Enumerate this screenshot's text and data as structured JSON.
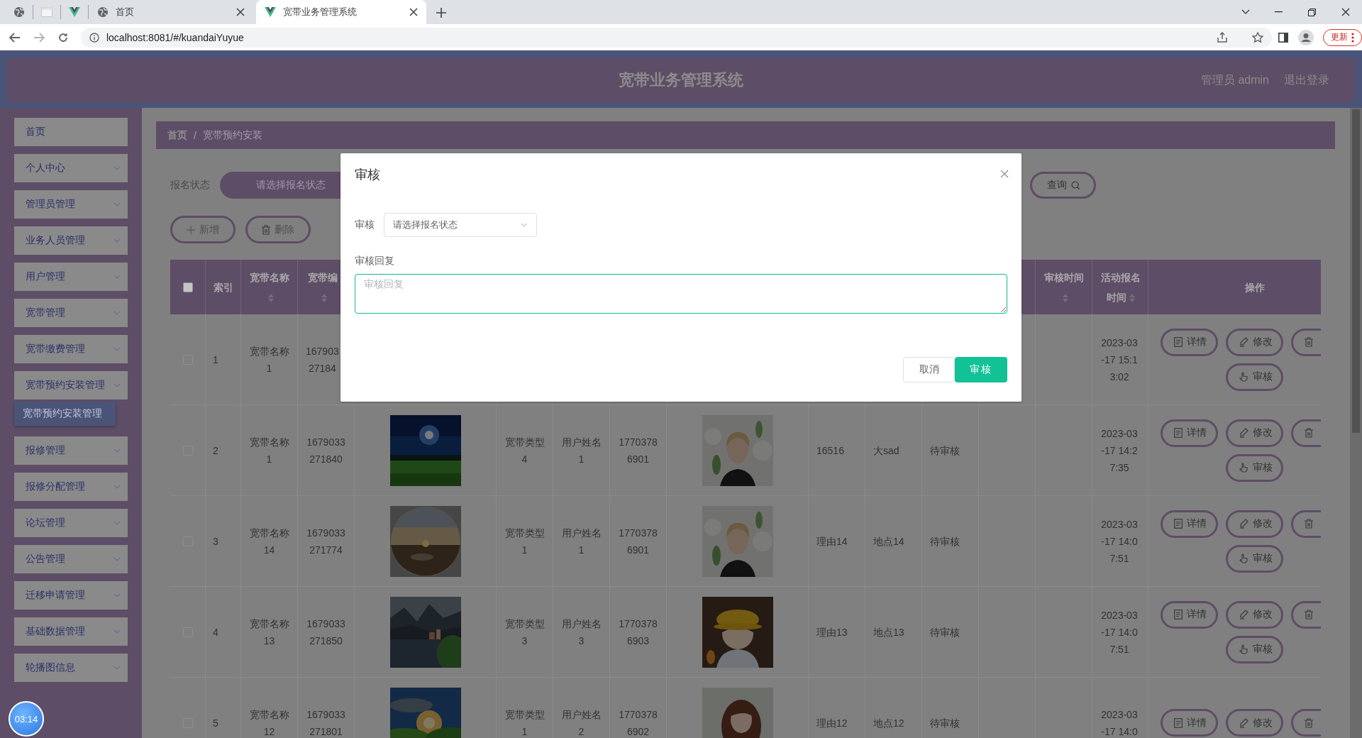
{
  "browser": {
    "tabs": [
      {
        "title": "首页",
        "selected": false
      },
      {
        "title": "宽带业务管理系统",
        "selected": true
      }
    ],
    "address": "localhost:8081/#/kuandaiYuyue",
    "update_button": "更新"
  },
  "header": {
    "title": "宽带业务管理系统",
    "user": "管理员 admin",
    "logout": "退出登录"
  },
  "sidebar": {
    "items": [
      {
        "label": "首页",
        "kind": "link"
      },
      {
        "label": "个人中心",
        "kind": "menu"
      },
      {
        "label": "管理员管理",
        "kind": "menu"
      },
      {
        "label": "业务人员管理",
        "kind": "menu"
      },
      {
        "label": "用户管理",
        "kind": "menu"
      },
      {
        "label": "宽带管理",
        "kind": "menu"
      },
      {
        "label": "宽带缴费管理",
        "kind": "menu"
      },
      {
        "label": "宽带预约安装管理",
        "kind": "menu",
        "children": [
          {
            "label": "宽带预约安装管理",
            "selected": true
          }
        ]
      },
      {
        "label": "报修管理",
        "kind": "menu"
      },
      {
        "label": "报修分配管理",
        "kind": "menu"
      },
      {
        "label": "论坛管理",
        "kind": "menu"
      },
      {
        "label": "公告管理",
        "kind": "menu"
      },
      {
        "label": "迁移申请管理",
        "kind": "menu"
      },
      {
        "label": "基础数据管理",
        "kind": "menu"
      },
      {
        "label": "轮播图信息",
        "kind": "menu"
      }
    ]
  },
  "breadcrumb": {
    "items": [
      "首页",
      "宽带预约安装"
    ],
    "separator": "/"
  },
  "search": {
    "label": "报名状态",
    "placeholder": "请选择报名状态",
    "button": "查询"
  },
  "toolbar": [
    {
      "kind": "add",
      "label": "新增"
    },
    {
      "kind": "delete",
      "label": "删除"
    }
  ],
  "table": {
    "select_all": {
      "checked": false
    },
    "columns": [
      {
        "kind": "header",
        "label": "索引",
        "sortable": false
      },
      {
        "kind": "header",
        "label": "宽带名称",
        "sortable": true
      },
      {
        "kind": "header",
        "label": "宽带编",
        "sortable": true
      },
      {
        "kind": "covered"
      },
      {
        "kind": "covered"
      },
      {
        "kind": "covered"
      },
      {
        "kind": "covered"
      },
      {
        "kind": "covered"
      },
      {
        "kind": "covered"
      },
      {
        "kind": "covered"
      },
      {
        "kind": "covered"
      },
      {
        "kind": "covered"
      },
      {
        "kind": "header",
        "label": "审核时间",
        "sortable": true
      },
      {
        "kind": "header",
        "label": "活动报名时间",
        "sortable": true
      },
      {
        "kind": "header",
        "label": "操作",
        "sortable": false
      }
    ],
    "rows": [
      {
        "checked": false,
        "cells": [
          {
            "kind": "text",
            "text": "1"
          },
          {
            "kind": "text",
            "text": "宽带名称1"
          },
          {
            "kind": "text",
            "text": "167903\n27184"
          },
          {
            "kind": "blank"
          },
          {
            "kind": "blank"
          },
          {
            "kind": "blank"
          },
          {
            "kind": "blank"
          },
          {
            "kind": "blank"
          },
          {
            "kind": "blank"
          },
          {
            "kind": "blank"
          },
          {
            "kind": "blank"
          },
          {
            "kind": "blank"
          },
          {
            "kind": "blank"
          },
          {
            "kind": "text",
            "text": "2023-03-17 15:13:02"
          }
        ],
        "actions": [
          {
            "kind": "detail",
            "label": "详情"
          },
          {
            "kind": "edit",
            "label": "修改"
          },
          {
            "kind": "delete"
          },
          {
            "kind": "review",
            "label": "审核"
          }
        ]
      },
      {
        "checked": false,
        "cells": [
          {
            "kind": "text",
            "text": "2"
          },
          {
            "kind": "text",
            "text": "宽带名称1"
          },
          {
            "kind": "text",
            "text": "1679033271840"
          },
          {
            "kind": "picture"
          },
          {
            "kind": "text",
            "text": "宽带类型4"
          },
          {
            "kind": "text",
            "text": "用户姓名1"
          },
          {
            "kind": "text",
            "text": "17703786901"
          },
          {
            "kind": "picture"
          },
          {
            "kind": "text",
            "text": "16516"
          },
          {
            "kind": "text",
            "text": "大sad"
          },
          {
            "kind": "text",
            "text": "待审核"
          },
          {
            "kind": "blank"
          },
          {
            "kind": "blank"
          },
          {
            "kind": "text",
            "text": "2023-03-17 14:27:35"
          }
        ],
        "actions": [
          {
            "kind": "detail",
            "label": "详情"
          },
          {
            "kind": "edit",
            "label": "修改"
          },
          {
            "kind": "delete"
          },
          {
            "kind": "review",
            "label": "审核"
          }
        ]
      },
      {
        "checked": false,
        "cells": [
          {
            "kind": "text",
            "text": "3"
          },
          {
            "kind": "text",
            "text": "宽带名称14"
          },
          {
            "kind": "text",
            "text": "1679033271774"
          },
          {
            "kind": "picture"
          },
          {
            "kind": "text",
            "text": "宽带类型1"
          },
          {
            "kind": "text",
            "text": "用户姓名1"
          },
          {
            "kind": "text",
            "text": "17703786901"
          },
          {
            "kind": "picture"
          },
          {
            "kind": "text",
            "text": "理由14"
          },
          {
            "kind": "text",
            "text": "地点14"
          },
          {
            "kind": "text",
            "text": "待审核"
          },
          {
            "kind": "blank"
          },
          {
            "kind": "blank"
          },
          {
            "kind": "text",
            "text": "2023-03-17 14:07:51"
          }
        ],
        "actions": [
          {
            "kind": "detail",
            "label": "详情"
          },
          {
            "kind": "edit",
            "label": "修改"
          },
          {
            "kind": "delete"
          },
          {
            "kind": "review",
            "label": "审核"
          }
        ]
      },
      {
        "checked": false,
        "cells": [
          {
            "kind": "text",
            "text": "4"
          },
          {
            "kind": "text",
            "text": "宽带名称13"
          },
          {
            "kind": "text",
            "text": "1679033271850"
          },
          {
            "kind": "picture"
          },
          {
            "kind": "text",
            "text": "宽带类型3"
          },
          {
            "kind": "text",
            "text": "用户姓名3"
          },
          {
            "kind": "text",
            "text": "17703786903"
          },
          {
            "kind": "picture"
          },
          {
            "kind": "text",
            "text": "理由13"
          },
          {
            "kind": "text",
            "text": "地点13"
          },
          {
            "kind": "text",
            "text": "待审核"
          },
          {
            "kind": "blank"
          },
          {
            "kind": "blank"
          },
          {
            "kind": "text",
            "text": "2023-03-17 14:07:51"
          }
        ],
        "actions": [
          {
            "kind": "detail",
            "label": "详情"
          },
          {
            "kind": "edit",
            "label": "修改"
          },
          {
            "kind": "delete"
          },
          {
            "kind": "review",
            "label": "审核"
          }
        ]
      },
      {
        "checked": false,
        "cells": [
          {
            "kind": "text",
            "text": "5"
          },
          {
            "kind": "text",
            "text": "宽带名称12"
          },
          {
            "kind": "text",
            "text": "1679033271801"
          },
          {
            "kind": "picture"
          },
          {
            "kind": "text",
            "text": "宽带类型1"
          },
          {
            "kind": "text",
            "text": "用户姓名2"
          },
          {
            "kind": "text",
            "text": "17703786902"
          },
          {
            "kind": "picture"
          },
          {
            "kind": "text",
            "text": "理由12"
          },
          {
            "kind": "text",
            "text": "地点12"
          },
          {
            "kind": "text",
            "text": "待审核"
          },
          {
            "kind": "blank"
          },
          {
            "kind": "blank"
          },
          {
            "kind": "text",
            "text": "2023-03-17 14:0"
          }
        ],
        "actions": [
          {
            "kind": "detail",
            "label": "详情"
          },
          {
            "kind": "edit",
            "label": "修改"
          },
          {
            "kind": "delete"
          }
        ]
      }
    ]
  },
  "dialog": {
    "title": "审核",
    "fields": [
      {
        "kind": "select",
        "label": "审核",
        "placeholder": "请选择报名状态"
      },
      {
        "kind": "textarea",
        "label": "审核回复",
        "placeholder": "审核回复",
        "focused": true
      }
    ],
    "buttons": [
      {
        "kind": "secondary",
        "label": "取消"
      },
      {
        "kind": "primary",
        "label": "审核"
      }
    ]
  },
  "recorder_badge": "03:14"
}
